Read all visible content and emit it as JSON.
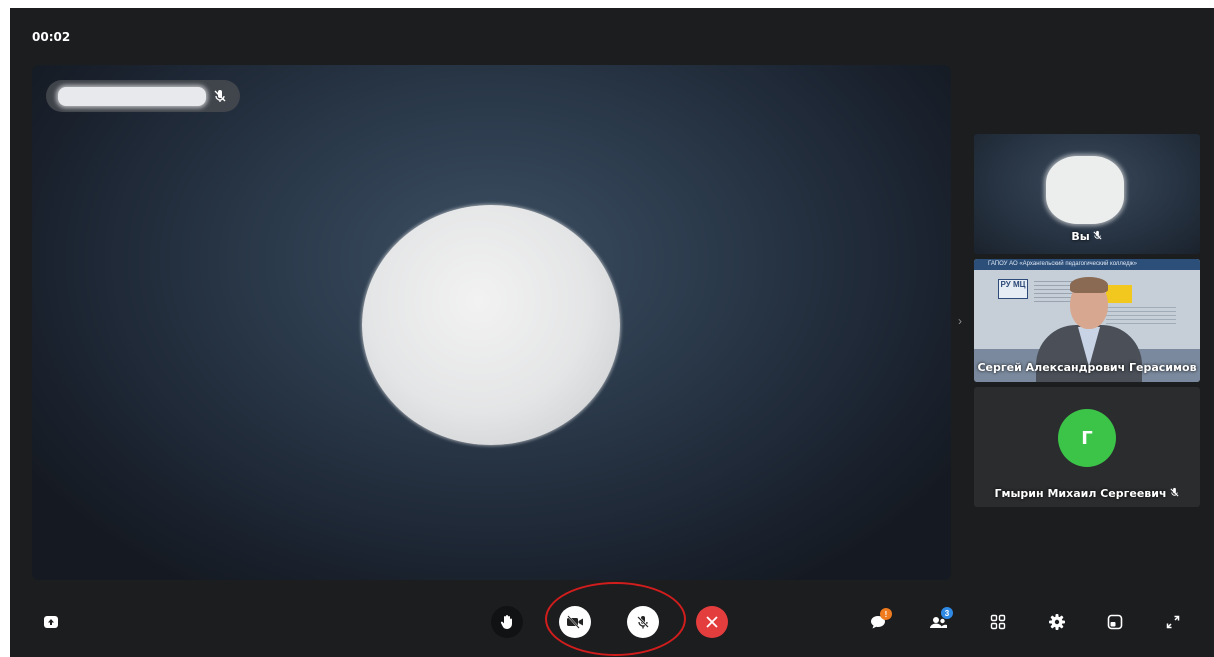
{
  "call": {
    "timer": "00:02"
  },
  "main_speaker": {
    "name": ""
  },
  "participants": [
    {
      "label": "Вы",
      "muted": true
    },
    {
      "label": "Сергей Александрович Герасимов",
      "muted": false,
      "video_banner": "ГАПОУ АО «Архангельский педагогический колледж»",
      "logo_text": "РУ МЦ"
    },
    {
      "label": "Гмырин Михаил Сергеевич",
      "muted": true,
      "initial": "Г"
    }
  ],
  "toolbar": {
    "chat_badge": "!",
    "participants_badge": "3"
  },
  "colors": {
    "background": "#1c1d1f",
    "end_call": "#e43d3d",
    "avatar_green": "#3cc448",
    "badge_orange": "#f07b1e",
    "badge_blue": "#2f8ae6",
    "highlight": "#d21d1d"
  },
  "icons": {
    "share_screen": "share-screen-icon",
    "raise_hand": "raise-hand-icon",
    "camera_off": "camera-off-icon",
    "mic_off": "mic-off-icon",
    "end_call": "close-icon",
    "chat": "chat-icon",
    "participants": "participants-icon",
    "layout_grid": "grid-icon",
    "settings": "gear-icon",
    "pip": "pip-icon",
    "fullscreen": "fullscreen-icon"
  }
}
